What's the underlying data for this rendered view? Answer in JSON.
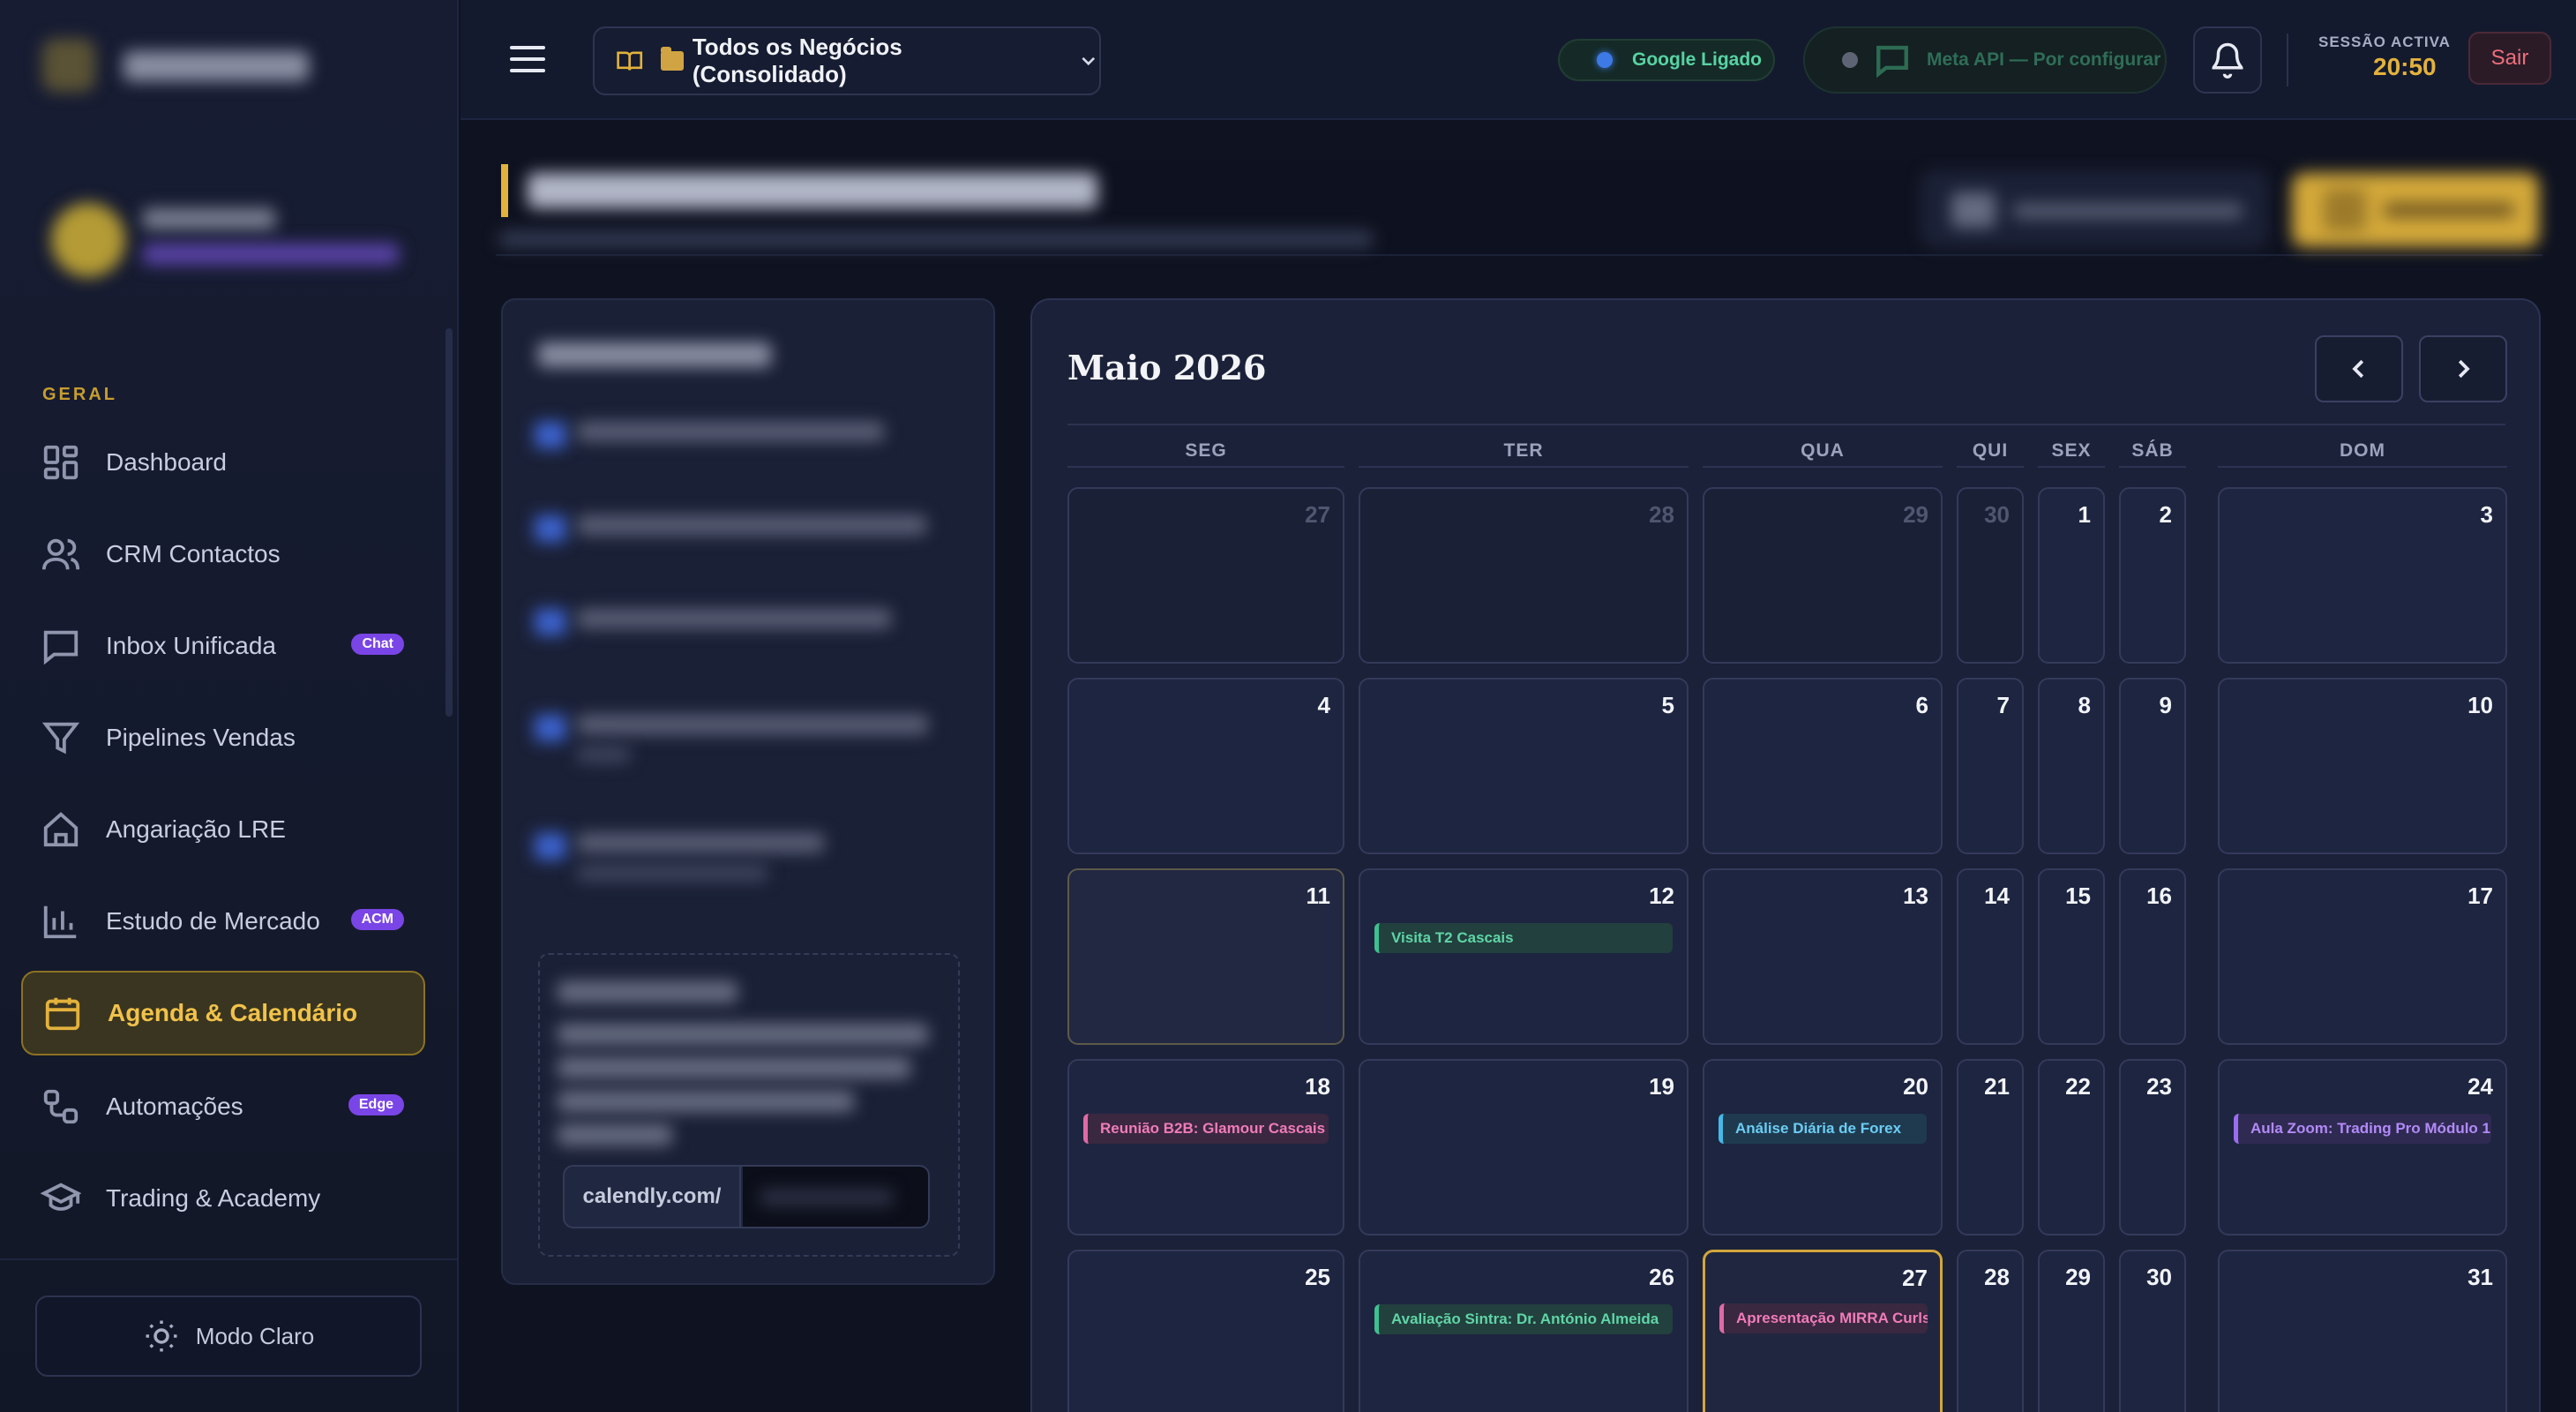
{
  "sidebar": {
    "section_label": "GERAL",
    "items": [
      {
        "label": "Dashboard",
        "icon": "grid-icon",
        "badge": ""
      },
      {
        "label": "CRM Contactos",
        "icon": "users-icon",
        "badge": ""
      },
      {
        "label": "Inbox Unificada",
        "icon": "chat-icon",
        "badge": "Chat"
      },
      {
        "label": "Pipelines Vendas",
        "icon": "filter-icon",
        "badge": ""
      },
      {
        "label": "Angariação LRE",
        "icon": "home-icon",
        "badge": ""
      },
      {
        "label": "Estudo de Mercado",
        "icon": "bar-chart-icon",
        "badge": "ACM"
      },
      {
        "label": "Agenda & Calendário",
        "icon": "calendar-icon",
        "badge": "",
        "active": true
      },
      {
        "label": "Automações",
        "icon": "workflow-icon",
        "badge": "Edge"
      },
      {
        "label": "Trading & Academy",
        "icon": "graduation-cap-icon",
        "badge": ""
      }
    ],
    "theme_toggle": "Modo Claro"
  },
  "topbar": {
    "business_selector": "Todos os Negócios (Consolidado)",
    "google_status": "Google Ligado",
    "meta_status": "Meta API — Por configurar",
    "session_label": "SESSÃO ACTIVA",
    "session_time": "20:50",
    "logout": "Sair"
  },
  "filters": {
    "url_prefix": "calendly.com/"
  },
  "calendar": {
    "month_title": "Maio 2026",
    "weekdays": [
      "SEG",
      "TER",
      "QUA",
      "QUI",
      "SEX",
      "SÁB",
      "DOM"
    ],
    "weeks": [
      [
        {
          "d": "27",
          "other": true
        },
        {
          "d": "28",
          "other": true
        },
        {
          "d": "29",
          "other": true
        },
        {
          "d": "30",
          "other": true
        },
        {
          "d": "1"
        },
        {
          "d": "2"
        },
        {
          "d": "3"
        }
      ],
      [
        {
          "d": "4"
        },
        {
          "d": "5"
        },
        {
          "d": "6"
        },
        {
          "d": "7"
        },
        {
          "d": "8"
        },
        {
          "d": "9"
        },
        {
          "d": "10"
        }
      ],
      [
        {
          "d": "11",
          "highlight": true
        },
        {
          "d": "12",
          "event": "Visita T2 Cascais",
          "color": "green"
        },
        {
          "d": "13"
        },
        {
          "d": "14"
        },
        {
          "d": "15"
        },
        {
          "d": "16"
        },
        {
          "d": "17"
        }
      ],
      [
        {
          "d": "18",
          "event": "Reunião B2B: Glamour Cascais",
          "color": "pink"
        },
        {
          "d": "19"
        },
        {
          "d": "20",
          "event": "Análise Diária de Forex",
          "color": "blue"
        },
        {
          "d": "21"
        },
        {
          "d": "22"
        },
        {
          "d": "23"
        },
        {
          "d": "24",
          "event": "Aula Zoom: Trading Pro Módulo 1",
          "color": "purple"
        }
      ],
      [
        {
          "d": "25"
        },
        {
          "d": "26",
          "event": "Avaliação Sintra: Dr. António Almeida",
          "color": "green"
        },
        {
          "d": "27",
          "today": true,
          "event": "Apresentação MIRRA Curls",
          "color": "pink"
        },
        {
          "d": "28"
        },
        {
          "d": "29"
        },
        {
          "d": "30"
        },
        {
          "d": "31"
        }
      ]
    ]
  }
}
